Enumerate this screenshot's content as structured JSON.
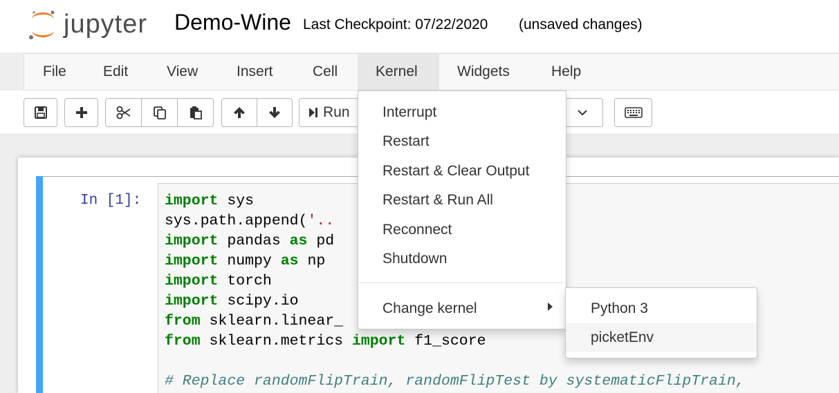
{
  "header": {
    "logo_text": "jupyter",
    "notebook_title": "Demo-Wine",
    "checkpoint": "Last Checkpoint: 07/22/2020",
    "status": "(unsaved changes)"
  },
  "menubar": {
    "items": [
      "File",
      "Edit",
      "View",
      "Insert",
      "Cell",
      "Kernel",
      "Widgets",
      "Help"
    ],
    "active": "Kernel"
  },
  "toolbar": {
    "run_label": "Run"
  },
  "cell": {
    "prompt": "In [1]:",
    "lines": [
      [
        [
          "kw",
          "import"
        ],
        [
          "t",
          " sys"
        ]
      ],
      [
        [
          "t",
          "sys.path.append("
        ],
        [
          "str",
          "'.."
        ]
      ],
      [
        [
          "kw",
          "import"
        ],
        [
          "t",
          " pandas "
        ],
        [
          "kw",
          "as"
        ],
        [
          "t",
          " pd"
        ]
      ],
      [
        [
          "kw",
          "import"
        ],
        [
          "t",
          " numpy "
        ],
        [
          "kw",
          "as"
        ],
        [
          "t",
          " np"
        ]
      ],
      [
        [
          "kw",
          "import"
        ],
        [
          "t",
          " torch"
        ]
      ],
      [
        [
          "kw",
          "import"
        ],
        [
          "t",
          " scipy.io"
        ]
      ],
      [
        [
          "kw",
          "from"
        ],
        [
          "t",
          " sklearn.linear_"
        ]
      ],
      [
        [
          "kw",
          "from"
        ],
        [
          "t",
          " sklearn.metrics "
        ],
        [
          "kw",
          "import"
        ],
        [
          "t",
          " f1_score"
        ]
      ],
      [
        [
          "t",
          ""
        ]
      ],
      [
        [
          "cm",
          "# Replace randomFlipTrain, randomFlipTest by systematicFlipTrain,"
        ]
      ]
    ]
  },
  "kernel_menu": {
    "items": [
      "Interrupt",
      "Restart",
      "Restart & Clear Output",
      "Restart & Run All",
      "Reconnect",
      "Shutdown"
    ],
    "change_kernel": "Change kernel"
  },
  "kernel_submenu": {
    "items": [
      "Python 3",
      "picketEnv"
    ],
    "highlighted": "picketEnv"
  }
}
